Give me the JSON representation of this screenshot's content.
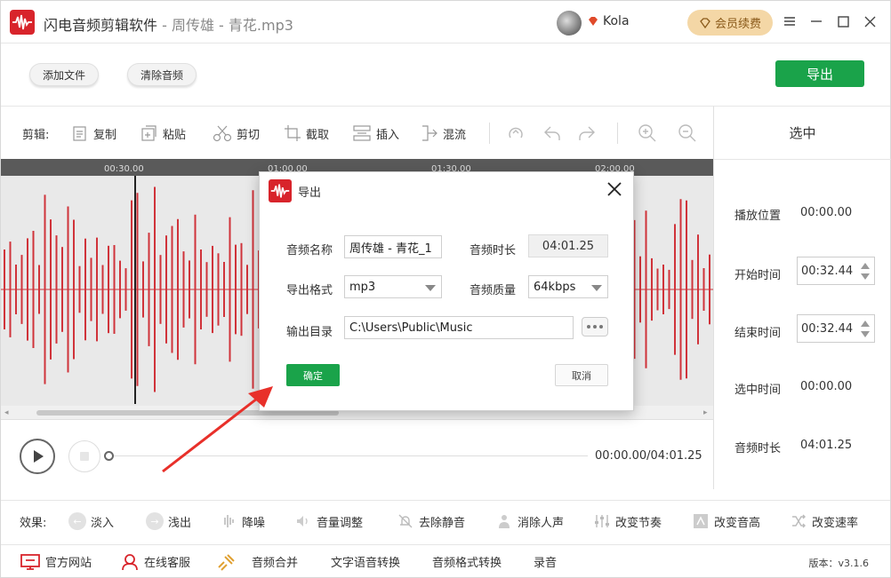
{
  "titlebar": {
    "app_name": "闪电音频剪辑软件",
    "file_name": " - 周传雄 - 青花.mp3",
    "username": "Kola",
    "vip_label": "会员续费"
  },
  "top_buttons": {
    "add_file": "添加文件",
    "clear_audio": "清除音频",
    "export": "导出"
  },
  "toolbar": {
    "label": "剪辑:",
    "copy": "复制",
    "paste": "粘贴",
    "cut": "剪切",
    "crop": "截取",
    "insert": "插入",
    "mix": "混流"
  },
  "ruler": {
    "t1": "00:30.00",
    "t2": "01:00.00",
    "t3": "01:30.00",
    "t4": "02:00.00"
  },
  "right_panel": {
    "title": "选中",
    "play_pos_label": "播放位置",
    "play_pos": "00:00.00",
    "start_label": "开始时间",
    "start": "00:32.44",
    "end_label": "结束时间",
    "end": "00:32.44",
    "sel_label": "选中时间",
    "sel": "00:00.00",
    "dur_label": "音频时长",
    "dur": "04:01.25"
  },
  "player": {
    "timecode": "00:00.00/04:01.25"
  },
  "effects": {
    "label": "效果:",
    "fade_in": "淡入",
    "fade_out": "浅出",
    "denoise": "降噪",
    "volume": "音量调整",
    "remove_silence": "去除静音",
    "remove_vocal": "消除人声",
    "tempo": "改变节奏",
    "pitch": "改变音高",
    "speed": "改变速率"
  },
  "footer": {
    "website": "官方网站",
    "service": "在线客服",
    "merge": "音频合并",
    "tts": "文字语音转换",
    "format": "音频格式转换",
    "record": "录音",
    "version": "版本：v3.1.6"
  },
  "dialog": {
    "title": "导出",
    "name_label": "音频名称",
    "name_value": "周传雄 - 青花_1",
    "duration_label": "音频时长",
    "duration_value": "04:01.25",
    "format_label": "导出格式",
    "format_value": "mp3",
    "quality_label": "音频质量",
    "quality_value": "64kbps",
    "dir_label": "输出目录",
    "dir_value": "C:\\Users\\Public\\Music",
    "ok": "确定",
    "cancel": "取消"
  },
  "colors": {
    "brand_red": "#d8242b",
    "accent_green": "#1aa34a",
    "wave_red": "#d0333a",
    "vip_gold": "#f4d7a6"
  }
}
